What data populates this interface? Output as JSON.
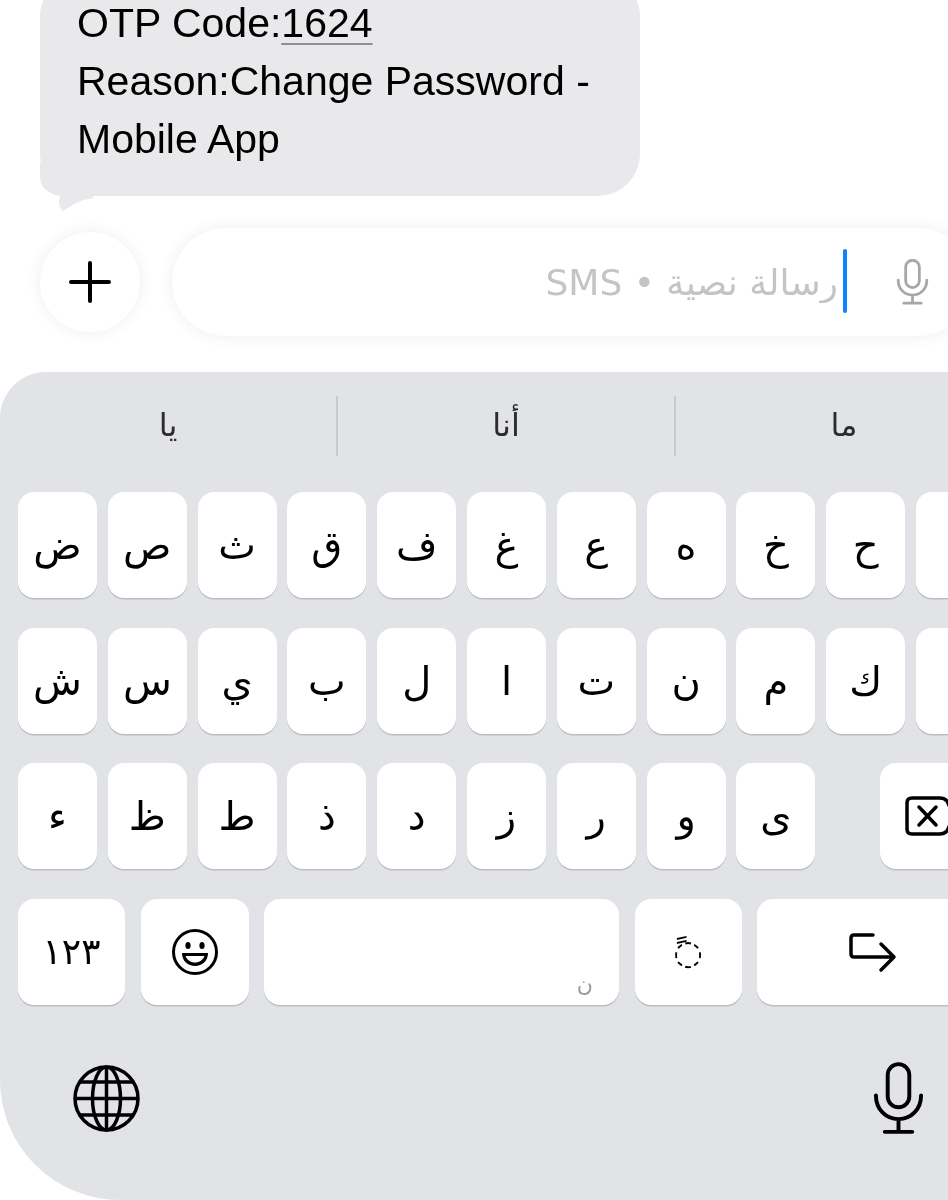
{
  "message_bubble": {
    "code_label": "OTP Code:",
    "code": "1624",
    "text": "Reason:Change Password - Mobile App"
  },
  "compose_bar": {
    "placeholder": "رسالة نصية • SMS",
    "focused": true
  },
  "keyboard": {
    "suggestions": [
      {
        "text": "ما"
      },
      {
        "text": "أنا"
      },
      {
        "text": "يا"
      }
    ],
    "rows": [
      {
        "keys": [
          {
            "kind": "letter"
          },
          {
            "kind": "letter",
            "label": "ح"
          },
          {
            "kind": "letter",
            "label": "خ"
          },
          {
            "kind": "letter",
            "label": "ه"
          },
          {
            "kind": "letter",
            "label": "ع"
          },
          {
            "kind": "letter",
            "label": "غ"
          },
          {
            "kind": "letter",
            "label": "ف"
          },
          {
            "kind": "letter",
            "label": "ق"
          },
          {
            "kind": "letter",
            "label": "ث"
          },
          {
            "kind": "letter",
            "label": "ص"
          },
          {
            "kind": "letter",
            "label": "ض"
          }
        ]
      },
      {
        "keys": [
          {
            "kind": "letter"
          },
          {
            "kind": "letter",
            "label": "ك"
          },
          {
            "kind": "letter",
            "label": "م"
          },
          {
            "kind": "letter",
            "label": "ن"
          },
          {
            "kind": "letter",
            "label": "ت"
          },
          {
            "kind": "letter",
            "label": "ا"
          },
          {
            "kind": "letter",
            "label": "ل"
          },
          {
            "kind": "letter",
            "label": "ب"
          },
          {
            "kind": "letter",
            "label": "ي"
          },
          {
            "kind": "letter",
            "label": "س"
          },
          {
            "kind": "letter",
            "label": "ش"
          }
        ]
      },
      {
        "keys": [
          {
            "kind": "delete"
          },
          {
            "kind": "letter",
            "label": "ى"
          },
          {
            "kind": "letter",
            "label": "و"
          },
          {
            "kind": "letter",
            "label": "ر"
          },
          {
            "kind": "letter",
            "label": "ز"
          },
          {
            "kind": "letter",
            "label": "د"
          },
          {
            "kind": "letter",
            "label": "ذ"
          },
          {
            "kind": "letter",
            "label": "ط"
          },
          {
            "kind": "letter",
            "label": "ظ"
          },
          {
            "kind": "letter",
            "label": "ء"
          }
        ]
      },
      {
        "keys": [
          {
            "kind": "return"
          },
          {
            "kind": "diacritic",
            "label": "◌ً"
          },
          {
            "kind": "space",
            "hint": "ن"
          },
          {
            "kind": "emoji"
          },
          {
            "kind": "numbers",
            "label": "١٢٣"
          }
        ]
      }
    ]
  }
}
